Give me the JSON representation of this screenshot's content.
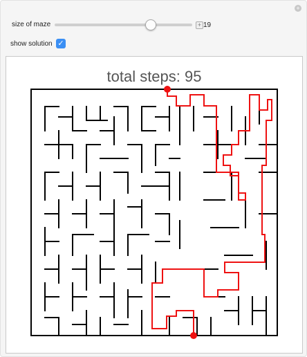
{
  "controls": {
    "size_label": "size of maze",
    "size_value": 19,
    "size_min": 5,
    "size_max": 25,
    "size_value_text": "19",
    "show_solution_label": "show solution",
    "show_solution_checked": true
  },
  "output": {
    "title": "total steps: 95"
  },
  "icons": {
    "corner": "plus-circle-icon",
    "slider_expand": "plus-box-icon",
    "checkbox": "check-icon"
  },
  "colors": {
    "solution": "#ee1111",
    "walls": "#000000",
    "checkbox": "#3b8ff4"
  }
}
